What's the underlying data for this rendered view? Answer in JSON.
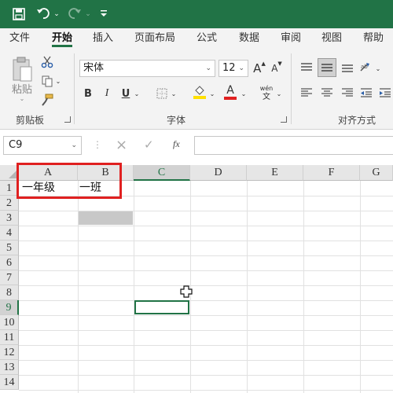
{
  "quick_access": {
    "save_icon": "save-icon",
    "undo_icon": "undo-icon",
    "redo_icon": "redo-icon",
    "customize_icon": "customize-icon"
  },
  "tabs": [
    "文件",
    "开始",
    "插入",
    "页面布局",
    "公式",
    "数据",
    "审阅",
    "视图",
    "帮助"
  ],
  "active_tab": "开始",
  "ribbon": {
    "clipboard": {
      "paste_label": "粘贴",
      "group_label": "剪贴板"
    },
    "font": {
      "font_name": "宋体",
      "font_size": "12",
      "grow_label": "A",
      "shrink_label": "A",
      "bold": "B",
      "italic": "I",
      "underline": "U",
      "font_color_label": "A",
      "phonetic_top": "wén",
      "phonetic_bottom": "文",
      "group_label": "字体"
    },
    "alignment": {
      "group_label": "对齐方式"
    }
  },
  "formula_bar": {
    "name_box": "C9",
    "cancel_icon": "×",
    "enter_icon": "✓",
    "fx_label": "fx",
    "formula": ""
  },
  "sheet": {
    "columns": [
      "A",
      "B",
      "C",
      "D",
      "E",
      "F",
      "G"
    ],
    "rows": [
      "1",
      "2",
      "3",
      "4",
      "5",
      "6",
      "7",
      "8",
      "9",
      "10",
      "11",
      "12",
      "13",
      "14"
    ],
    "cells": {
      "A1": "一年级",
      "B1": "一班"
    },
    "active_cell": "C9",
    "shaded_cell": "B3"
  },
  "colors": {
    "accent": "#217346",
    "highlight_box": "#e02020",
    "shaded_cell": "#c8c8c8"
  }
}
